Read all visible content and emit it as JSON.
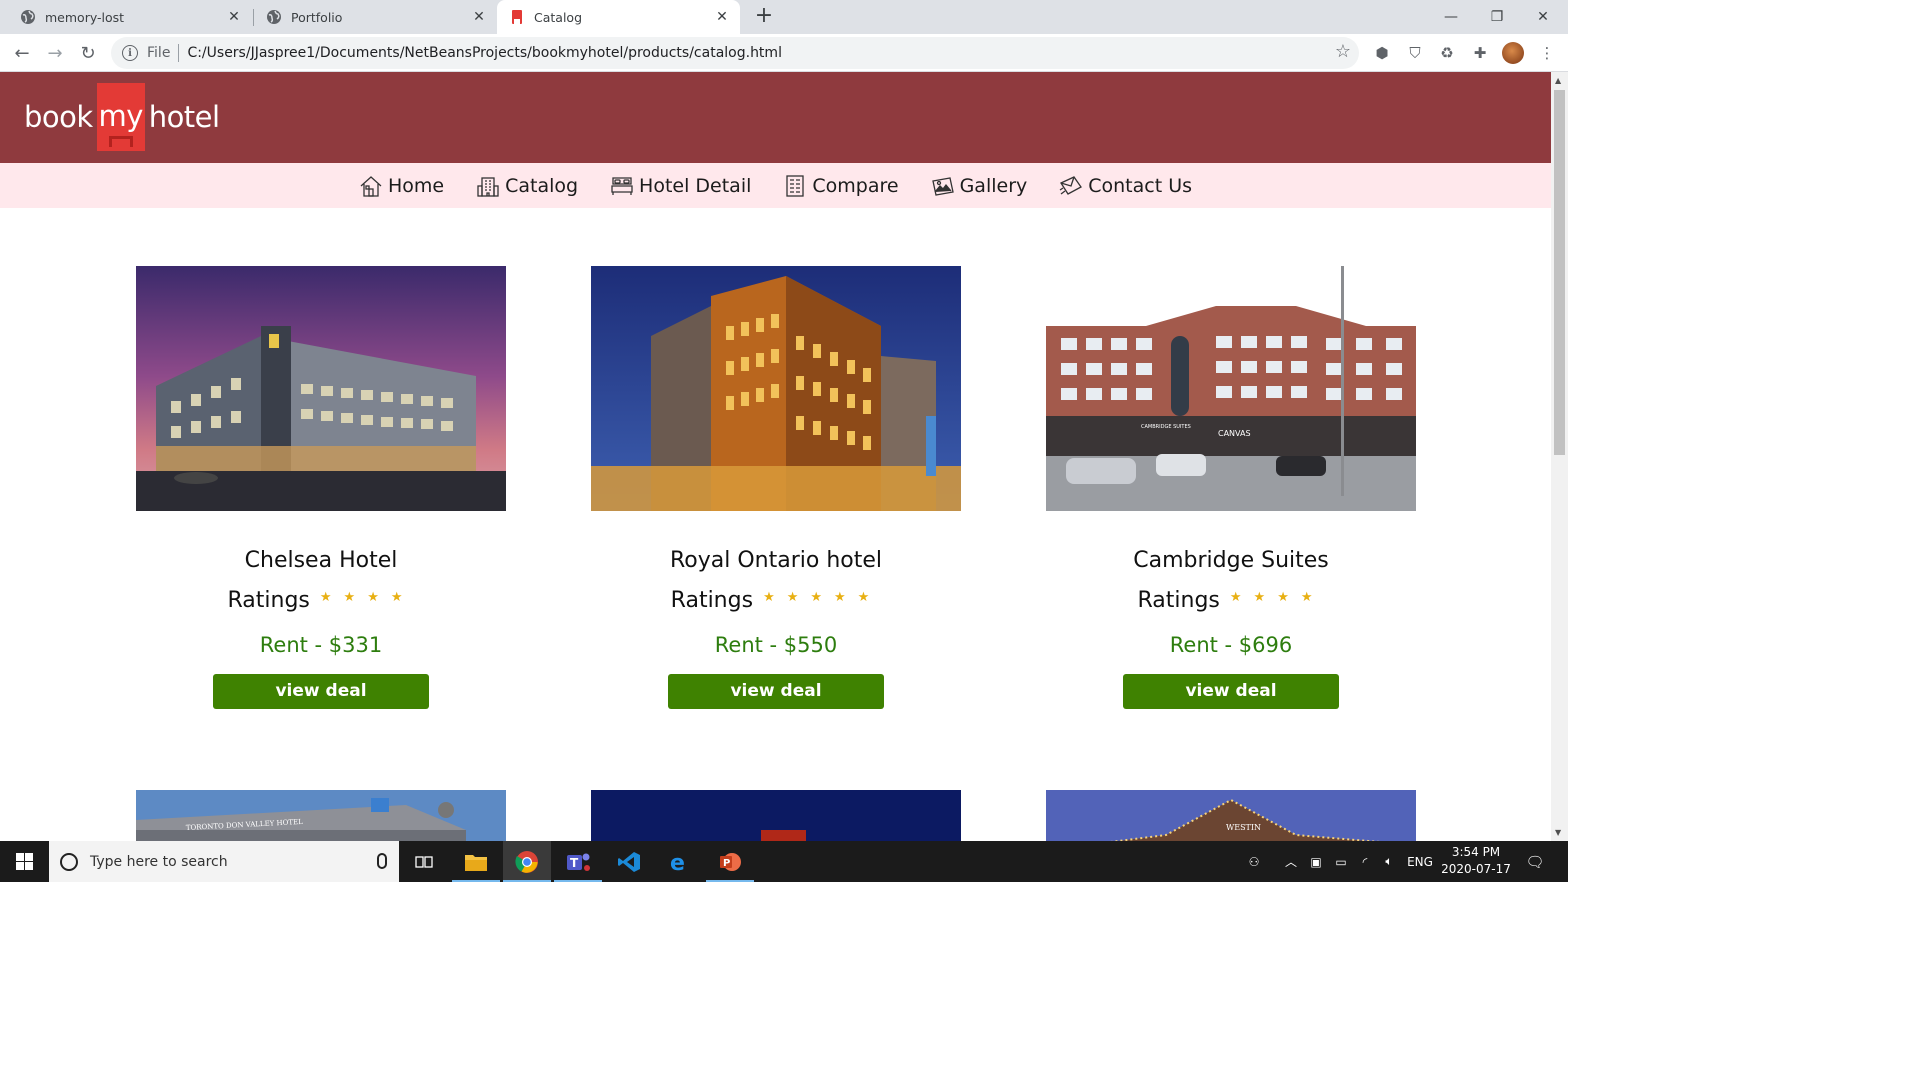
{
  "browser": {
    "tabs": [
      {
        "title": "memory-lost",
        "active": false
      },
      {
        "title": "Portfolio",
        "active": false
      },
      {
        "title": "Catalog",
        "active": true
      }
    ],
    "url_scheme": "File",
    "url": "C:/Users/JJaspree1/Documents/NetBeansProjects/bookmyhotel/products/catalog.html"
  },
  "site": {
    "logo": {
      "part1": "book",
      "part2": "my",
      "part3": "hotel"
    },
    "nav": [
      {
        "label": "Home",
        "icon": "house-icon"
      },
      {
        "label": "Catalog",
        "icon": "building-icon"
      },
      {
        "label": "Hotel Detail",
        "icon": "bed-icon"
      },
      {
        "label": "Compare",
        "icon": "compare-icon"
      },
      {
        "label": "Gallery",
        "icon": "gallery-icon"
      },
      {
        "label": "Contact Us",
        "icon": "envelope-icon"
      }
    ],
    "hotels": [
      {
        "name": "Chelsea Hotel",
        "ratings_label": "Ratings",
        "stars": "★★★★",
        "star_count": 4,
        "rent": "Rent - $331",
        "button": "view deal"
      },
      {
        "name": "Royal Ontario hotel",
        "ratings_label": "Ratings",
        "stars": "★★★★★",
        "star_count": 5,
        "rent": "Rent - $550",
        "button": "view deal"
      },
      {
        "name": "Cambridge Suites",
        "ratings_label": "Ratings",
        "stars": "★★★★",
        "star_count": 4,
        "rent": "Rent - $696",
        "button": "view deal"
      }
    ],
    "photo_signs": {
      "card3_sign1": "CAMBRIDGE SUITES",
      "card3_sign2": "CANVAS",
      "card4_sign": "TORONTO DON VALLEY HOTEL",
      "card6_sign": "WESTIN"
    }
  },
  "taskbar": {
    "search_placeholder": "Type here to search",
    "language": "ENG",
    "time": "3:54 PM",
    "date": "2020-07-17"
  },
  "colors": {
    "header": "#8f3a3e",
    "nav_bg": "#ffe8ec",
    "rent_text": "#2d7d0e",
    "button": "#3f8201",
    "star": "#e8b013"
  }
}
